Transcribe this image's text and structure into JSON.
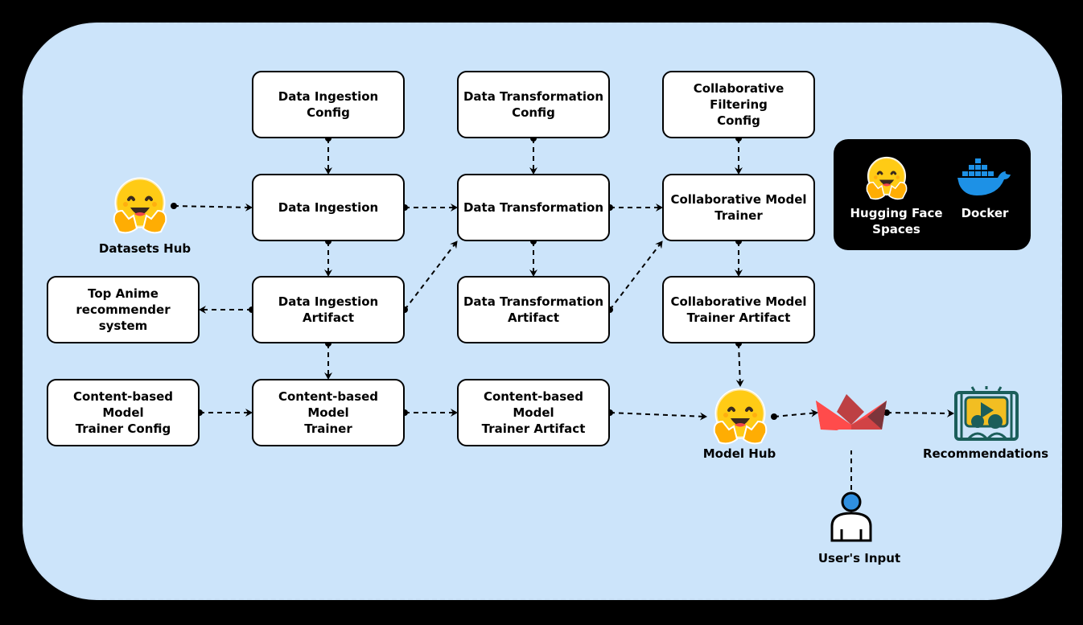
{
  "nodes": {
    "di_config": "Data Ingestion\nConfig",
    "dt_config": "Data Transformation\nConfig",
    "cf_config": "Collaborative Filtering\nConfig",
    "di": "Data Ingestion",
    "dt": "Data Transformation",
    "cmt": "Collaborative Model\nTrainer",
    "top_anime": "Top Anime\nrecommender system",
    "di_artifact": "Data Ingestion\nArtifact",
    "dt_artifact": "Data Transformation\nArtifact",
    "cmt_artifact": "Collaborative Model\nTrainer Artifact",
    "cb_config": "Content-based Model\nTrainer Config",
    "cb_trainer": "Content-based Model\nTrainer",
    "cb_artifact": "Content-based Model\nTrainer Artifact"
  },
  "icons": {
    "datasets_hub": "Datasets Hub",
    "model_hub": "Model Hub",
    "streamlit": "",
    "recommendations": "Recommendations",
    "user_input": "User's Input"
  },
  "legend": {
    "hf_spaces": "Hugging Face\nSpaces",
    "docker": "Docker"
  },
  "edges": [
    [
      "di_config",
      "di"
    ],
    [
      "dt_config",
      "dt"
    ],
    [
      "cf_config",
      "cmt"
    ],
    [
      "datasets_hub",
      "di"
    ],
    [
      "di",
      "dt"
    ],
    [
      "dt",
      "cmt"
    ],
    [
      "di",
      "di_artifact"
    ],
    [
      "dt",
      "dt_artifact"
    ],
    [
      "cmt",
      "cmt_artifact"
    ],
    [
      "di_artifact",
      "top_anime"
    ],
    [
      "di_artifact",
      "dt"
    ],
    [
      "dt_artifact",
      "cmt"
    ],
    [
      "di_artifact",
      "cb_trainer"
    ],
    [
      "cb_config",
      "cb_trainer"
    ],
    [
      "cb_trainer",
      "cb_artifact"
    ],
    [
      "cb_artifact",
      "model_hub"
    ],
    [
      "cmt_artifact",
      "model_hub"
    ],
    [
      "model_hub",
      "streamlit"
    ],
    [
      "streamlit",
      "recommendations"
    ],
    [
      "user_input",
      "streamlit"
    ]
  ]
}
